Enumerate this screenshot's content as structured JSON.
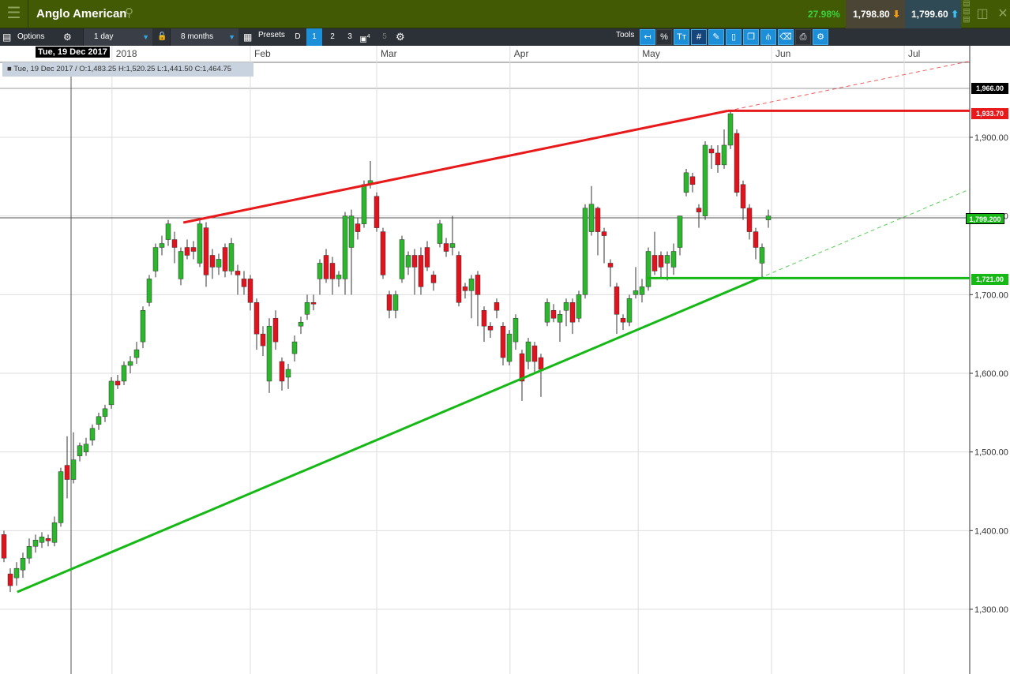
{
  "header": {
    "title": "Anglo American",
    "change": "27.98%",
    "sell": "1,798.80",
    "buy": "1,799.60"
  },
  "toolbar": {
    "options": "Options",
    "interval": "1 day",
    "range": "8 months",
    "presets": "Presets",
    "preset_buttons": [
      "D",
      "1",
      "2",
      "3",
      "4",
      "5"
    ],
    "tools": "Tools"
  },
  "crosshair": {
    "date": "Tue, 19 Dec 2017",
    "info": "■ Tue, 19 Dec 2017 / O:1,483.25  H:1,520.25  L:1,441.50  C:1,464.75"
  },
  "price_labels": {
    "top": "1,966.00",
    "red": "1,933.70",
    "current": "1,799.200",
    "green": "1,721.00"
  },
  "colors": {
    "up": "#2db52d",
    "down": "#e0141e",
    "red_line": "#e8191b",
    "green_line": "#16b816"
  },
  "chart_data": {
    "type": "candlestick",
    "symbol": "Anglo American",
    "ylim": [
      1220,
      2020
    ],
    "yticks": [
      {
        "v": 1300,
        "label": "1,300.00"
      },
      {
        "v": 1400,
        "label": "1,400.00"
      },
      {
        "v": 1500,
        "label": "1,500.00"
      },
      {
        "v": 1600,
        "label": "1,600.00"
      },
      {
        "v": 1700,
        "label": "1,700.00"
      },
      {
        "v": 1800,
        "label": "1,800.00"
      },
      {
        "v": 1900,
        "label": "1,900.00"
      }
    ],
    "xticks": [
      {
        "i": 17.6,
        "label": "2018"
      },
      {
        "i": 39.5,
        "label": "Feb"
      },
      {
        "i": 59.5,
        "label": "Mar"
      },
      {
        "i": 80.6,
        "label": "Apr"
      },
      {
        "i": 100.9,
        "label": "May"
      },
      {
        "i": 122,
        "label": "Jun"
      },
      {
        "i": 143,
        "label": "Jul"
      }
    ],
    "ohlc": [
      [
        1395,
        1400,
        1360,
        1365
      ],
      [
        1345,
        1352,
        1322,
        1330
      ],
      [
        1340,
        1360,
        1330,
        1352
      ],
      [
        1350,
        1372,
        1340,
        1365
      ],
      [
        1365,
        1390,
        1358,
        1380
      ],
      [
        1380,
        1395,
        1372,
        1388
      ],
      [
        1385,
        1398,
        1378,
        1392
      ],
      [
        1390,
        1395,
        1380,
        1387
      ],
      [
        1385,
        1418,
        1380,
        1410
      ],
      [
        1410,
        1480,
        1405,
        1475
      ],
      [
        1483,
        1520,
        1441,
        1465
      ],
      [
        1465,
        1525,
        1460,
        1490
      ],
      [
        1495,
        1512,
        1488,
        1508
      ],
      [
        1500,
        1518,
        1495,
        1510
      ],
      [
        1515,
        1535,
        1508,
        1530
      ],
      [
        1535,
        1550,
        1528,
        1545
      ],
      [
        1545,
        1560,
        1538,
        1555
      ],
      [
        1560,
        1595,
        1555,
        1590
      ],
      [
        1590,
        1598,
        1580,
        1585
      ],
      [
        1590,
        1615,
        1585,
        1610
      ],
      [
        1610,
        1622,
        1600,
        1615
      ],
      [
        1620,
        1640,
        1612,
        1630
      ],
      [
        1640,
        1685,
        1632,
        1680
      ],
      [
        1690,
        1725,
        1685,
        1720
      ],
      [
        1730,
        1765,
        1722,
        1760
      ],
      [
        1760,
        1775,
        1750,
        1765
      ],
      [
        1770,
        1795,
        1762,
        1790
      ],
      [
        1770,
        1780,
        1740,
        1760
      ],
      [
        1720,
        1760,
        1712,
        1755
      ],
      [
        1760,
        1770,
        1745,
        1750
      ],
      [
        1760,
        1768,
        1745,
        1755
      ],
      [
        1740,
        1795,
        1735,
        1790
      ],
      [
        1785,
        1792,
        1710,
        1725
      ],
      [
        1750,
        1758,
        1720,
        1735
      ],
      [
        1735,
        1752,
        1725,
        1745
      ],
      [
        1760,
        1765,
        1722,
        1730
      ],
      [
        1730,
        1772,
        1725,
        1765
      ],
      [
        1730,
        1738,
        1700,
        1725
      ],
      [
        1720,
        1730,
        1700,
        1710
      ],
      [
        1720,
        1725,
        1680,
        1690
      ],
      [
        1690,
        1695,
        1630,
        1650
      ],
      [
        1650,
        1660,
        1622,
        1635
      ],
      [
        1590,
        1670,
        1575,
        1660
      ],
      [
        1670,
        1680,
        1630,
        1640
      ],
      [
        1615,
        1620,
        1578,
        1590
      ],
      [
        1595,
        1612,
        1580,
        1605
      ],
      [
        1625,
        1648,
        1615,
        1640
      ],
      [
        1660,
        1672,
        1650,
        1665
      ],
      [
        1675,
        1700,
        1668,
        1690
      ],
      [
        1690,
        1700,
        1680,
        1688
      ],
      [
        1720,
        1745,
        1700,
        1740
      ],
      [
        1750,
        1758,
        1715,
        1720
      ],
      [
        1740,
        1748,
        1700,
        1720
      ],
      [
        1720,
        1730,
        1710,
        1725
      ],
      [
        1720,
        1805,
        1700,
        1800
      ],
      [
        1760,
        1808,
        1700,
        1800
      ],
      [
        1790,
        1798,
        1770,
        1780
      ],
      [
        1790,
        1845,
        1785,
        1840
      ],
      [
        1840,
        1870,
        1835,
        1845
      ],
      [
        1825,
        1830,
        1780,
        1785
      ],
      [
        1780,
        1785,
        1720,
        1725
      ],
      [
        1700,
        1705,
        1670,
        1680
      ],
      [
        1680,
        1705,
        1670,
        1700
      ],
      [
        1720,
        1775,
        1715,
        1770
      ],
      [
        1735,
        1755,
        1725,
        1750
      ],
      [
        1750,
        1758,
        1700,
        1735
      ],
      [
        1750,
        1760,
        1700,
        1710
      ],
      [
        1760,
        1768,
        1730,
        1735
      ],
      [
        1725,
        1730,
        1705,
        1715
      ],
      [
        1765,
        1795,
        1760,
        1790
      ],
      [
        1765,
        1772,
        1748,
        1755
      ],
      [
        1760,
        1800,
        1750,
        1765
      ],
      [
        1750,
        1755,
        1685,
        1690
      ],
      [
        1710,
        1715,
        1695,
        1705
      ],
      [
        1705,
        1725,
        1670,
        1720
      ],
      [
        1725,
        1730,
        1660,
        1700
      ],
      [
        1680,
        1685,
        1640,
        1660
      ],
      [
        1660,
        1665,
        1645,
        1655
      ],
      [
        1690,
        1695,
        1670,
        1680
      ],
      [
        1660,
        1665,
        1610,
        1620
      ],
      [
        1615,
        1655,
        1610,
        1650
      ],
      [
        1640,
        1675,
        1630,
        1670
      ],
      [
        1625,
        1630,
        1565,
        1590
      ],
      [
        1615,
        1645,
        1605,
        1640
      ],
      [
        1635,
        1640,
        1600,
        1615
      ],
      [
        1620,
        1625,
        1570,
        1605
      ],
      [
        1665,
        1695,
        1660,
        1690
      ],
      [
        1680,
        1688,
        1665,
        1670
      ],
      [
        1665,
        1680,
        1640,
        1675
      ],
      [
        1680,
        1695,
        1660,
        1690
      ],
      [
        1690,
        1695,
        1650,
        1665
      ],
      [
        1670,
        1705,
        1665,
        1700
      ],
      [
        1700,
        1815,
        1695,
        1810
      ],
      [
        1780,
        1838,
        1775,
        1815
      ],
      [
        1810,
        1812,
        1750,
        1780
      ],
      [
        1780,
        1785,
        1740,
        1775
      ],
      [
        1740,
        1745,
        1710,
        1735
      ],
      [
        1710,
        1715,
        1650,
        1675
      ],
      [
        1670,
        1675,
        1655,
        1665
      ],
      [
        1665,
        1700,
        1660,
        1695
      ],
      [
        1700,
        1735,
        1695,
        1705
      ],
      [
        1700,
        1720,
        1690,
        1710
      ],
      [
        1710,
        1760,
        1705,
        1755
      ],
      [
        1750,
        1780,
        1725,
        1730
      ],
      [
        1750,
        1755,
        1720,
        1735
      ],
      [
        1740,
        1755,
        1718,
        1750
      ],
      [
        1735,
        1765,
        1725,
        1755
      ],
      [
        1760,
        1800,
        1750,
        1800
      ],
      [
        1830,
        1860,
        1825,
        1855
      ],
      [
        1850,
        1855,
        1830,
        1840
      ],
      [
        1810,
        1815,
        1785,
        1805
      ],
      [
        1800,
        1895,
        1795,
        1890
      ],
      [
        1885,
        1890,
        1860,
        1880
      ],
      [
        1880,
        1890,
        1855,
        1865
      ],
      [
        1865,
        1910,
        1860,
        1890
      ],
      [
        1890,
        1935,
        1885,
        1930
      ],
      [
        1905,
        1910,
        1825,
        1830
      ],
      [
        1840,
        1845,
        1795,
        1810
      ],
      [
        1810,
        1815,
        1770,
        1780
      ],
      [
        1780,
        1785,
        1745,
        1760
      ],
      [
        1740,
        1765,
        1722,
        1760
      ],
      [
        1795,
        1808,
        1785,
        1800
      ]
    ],
    "trendlines": [
      {
        "name": "resistance",
        "from": [
          28.4,
          1791.6
        ],
        "to": [
          114.6,
          1933.7
        ],
        "color": "#e8191b"
      },
      {
        "name": "support",
        "from": [
          2.1,
          1322
        ],
        "to": [
          119.6,
          1721
        ],
        "color": "#16b816"
      }
    ],
    "horizontals": [
      {
        "name": "resistance-level",
        "start": 114.6,
        "value": 1933.7
      },
      {
        "name": "support-level",
        "start": 101.6,
        "value": 1721
      }
    ]
  }
}
